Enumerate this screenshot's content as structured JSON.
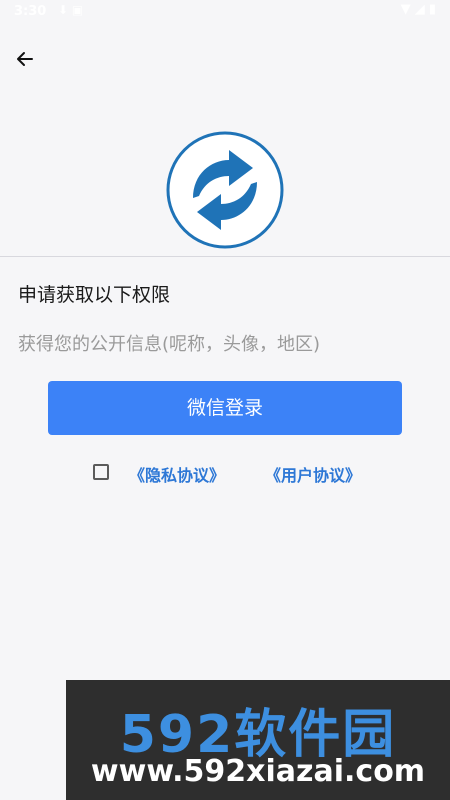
{
  "status_bar": {
    "time": "3:30",
    "left_icons": "⬇ ▣",
    "right_icons": "▼ ◢ ▮"
  },
  "nav": {
    "back_icon": "arrow-left-icon"
  },
  "logo": {
    "icon": "circular-arrows-logo",
    "color": "#1f73b7"
  },
  "permission": {
    "title": "申请获取以下权限",
    "description": "获得您的公开信息(呢称，头像，地区)"
  },
  "login_button": {
    "label": "微信登录",
    "color": "#3c82f7"
  },
  "agreement": {
    "checked": false,
    "privacy_label": "《隐私协议》",
    "user_label": "《用户协议》",
    "link_color": "#2e78d6"
  },
  "watermark": {
    "brand": "592软件园",
    "url": "www.592xiazai.com"
  }
}
